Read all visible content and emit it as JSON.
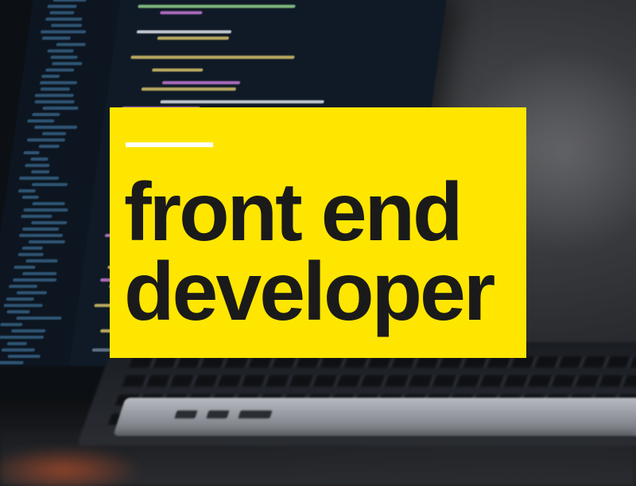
{
  "card": {
    "line1": "front end",
    "line2": "developer",
    "bg_color": "#ffe600",
    "accent_color": "#ffffff",
    "text_color": "#1a1a1a"
  },
  "photo": {
    "subject": "laptop-with-code"
  }
}
